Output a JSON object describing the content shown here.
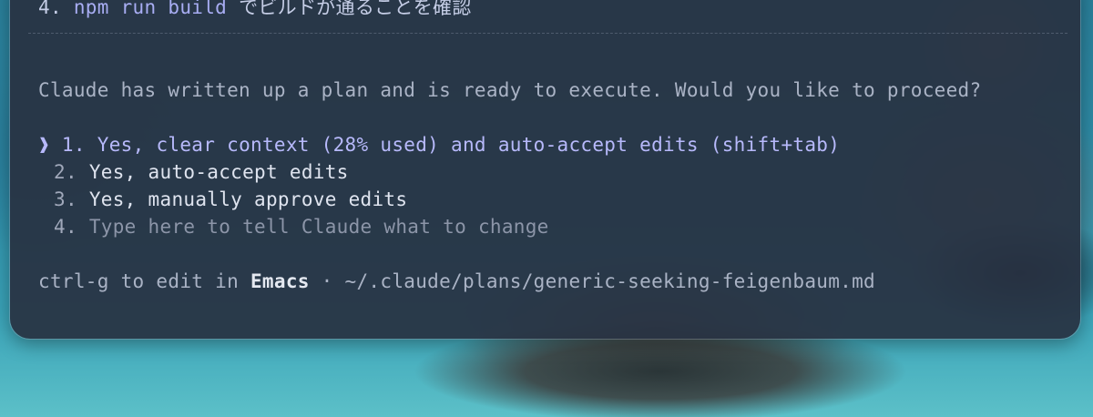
{
  "plan": {
    "step_number": "4.",
    "step_code": "npm run build",
    "step_text": "でビルドが通ることを確認"
  },
  "prompt": "Claude has written up a plan and is ready to execute. Would you like to proceed?",
  "options": [
    {
      "number": "1.",
      "label": "Yes, clear context (28% used) and auto-accept edits (shift+tab)",
      "selected": true
    },
    {
      "number": "2.",
      "label": "Yes, auto-accept edits",
      "selected": false
    },
    {
      "number": "3.",
      "label": "Yes, manually approve edits",
      "selected": false
    },
    {
      "number": "4.",
      "label": "Type here to tell Claude what to change",
      "selected": false
    }
  ],
  "cursor_glyph": "❱",
  "hint": {
    "prefix": "ctrl-g to edit in ",
    "editor": "Emacs",
    "separator": " · ",
    "path": "~/.claude/plans/generic-seeking-feigenbaum.md"
  },
  "colors": {
    "panel_bg": "#283242",
    "accent": "#b7b9fb",
    "text": "#dfe4ef",
    "muted": "#aab3c5"
  }
}
